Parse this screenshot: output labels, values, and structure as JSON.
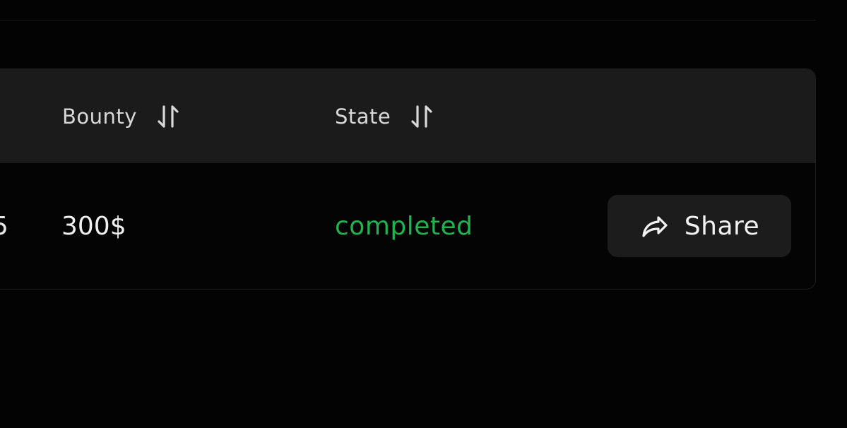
{
  "table": {
    "columns": [
      {
        "label": "Bounty",
        "sort_icon": "sort-arrows-icon"
      },
      {
        "label": "State",
        "sort_icon": "sort-arrows-icon"
      }
    ],
    "rows": [
      {
        "prev_cell_fragment": "5",
        "bounty": "300$",
        "state": "completed",
        "action": {
          "label": "Share",
          "icon": "share-arrow-icon"
        }
      }
    ]
  },
  "colors": {
    "background": "#030303",
    "header_background": "#1b1b1b",
    "state_completed": "#22b24f",
    "button_background": "#1c1c1c"
  }
}
